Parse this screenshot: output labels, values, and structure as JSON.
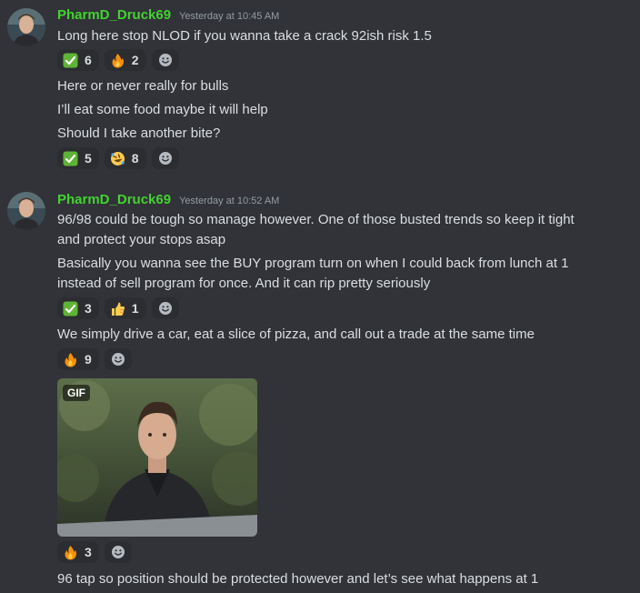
{
  "colors": {
    "background": "#313338",
    "username": "#43d32f",
    "text": "#dbdee1",
    "timestamp": "#949ba4",
    "reaction_bg": "#2b2d31"
  },
  "messages": [
    {
      "author": "PharmD_Druck69",
      "timestamp": "Yesterday at 10:45 AM",
      "blocks": [
        {
          "lines": [
            "Long here stop NLOD if you wanna take a crack 92ish risk 1.5"
          ],
          "reactions": [
            {
              "emoji": "check-mark",
              "count": "6"
            },
            {
              "emoji": "fire",
              "count": "2"
            }
          ]
        },
        {
          "lines": [
            "Here or never really for bulls",
            "I’ll eat some food maybe it will help",
            "Should I take another bite?"
          ],
          "reactions": [
            {
              "emoji": "check-mark",
              "count": "5"
            },
            {
              "emoji": "rolling-laughing",
              "count": "8"
            }
          ]
        }
      ]
    },
    {
      "author": "PharmD_Druck69",
      "timestamp": "Yesterday at 10:52 AM",
      "blocks": [
        {
          "lines": [
            "96/98 could be tough so manage however. One of those busted trends so keep it tight",
            "and protect your stops asap"
          ]
        },
        {
          "lines": [
            "Basically you wanna see the BUY program turn on when I could back from lunch at 1",
            "instead of sell program for once. And it can rip pretty seriously"
          ],
          "reactions": [
            {
              "emoji": "check-mark",
              "count": "3"
            },
            {
              "emoji": "thumbs-up",
              "count": "1"
            }
          ]
        },
        {
          "lines": [
            "We simply drive a car, eat a slice of pizza, and call out a trade at the same time"
          ],
          "reactions": [
            {
              "emoji": "fire",
              "count": "9"
            }
          ]
        },
        {
          "gif_label": "GIF",
          "reactions": [
            {
              "emoji": "fire",
              "count": "3"
            }
          ]
        },
        {
          "lines": [
            "96 tap so position should be protected however and let’s see what happens at 1"
          ]
        }
      ]
    }
  ]
}
